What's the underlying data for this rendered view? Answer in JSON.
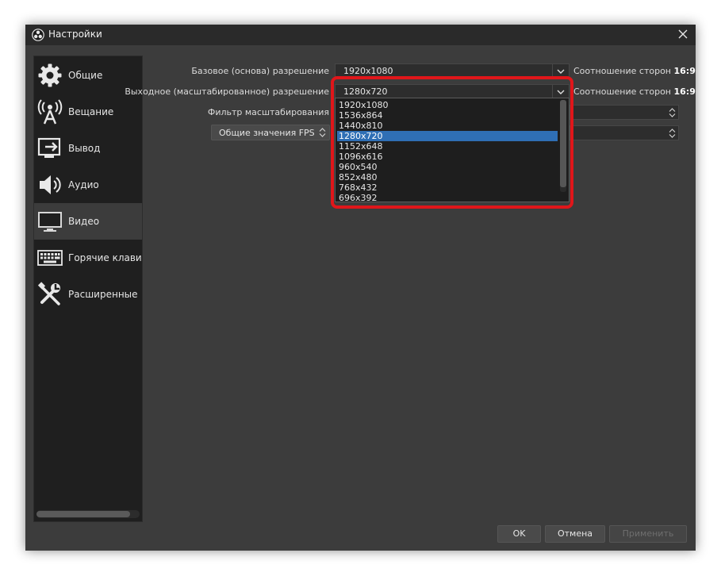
{
  "window": {
    "title": "Настройки"
  },
  "sidebar": {
    "items": [
      {
        "label": "Общие",
        "icon": "gear-icon"
      },
      {
        "label": "Вещание",
        "icon": "broadcast-icon"
      },
      {
        "label": "Вывод",
        "icon": "output-icon"
      },
      {
        "label": "Аудио",
        "icon": "speaker-icon"
      },
      {
        "label": "Видео",
        "icon": "monitor-icon",
        "active": true
      },
      {
        "label": "Горячие клавиши",
        "icon": "keyboard-icon"
      },
      {
        "label": "Расширенные",
        "icon": "tools-icon"
      }
    ]
  },
  "video": {
    "base_label": "Базовое (основа) разрешение",
    "base_value": "1920x1080",
    "base_aspect_text": "Соотношение сторон ",
    "base_aspect_ratio": "16:9",
    "output_label": "Выходное (масштабированное) разрешение",
    "output_value": "1280x720",
    "output_aspect_text": "Соотношение сторон ",
    "output_aspect_ratio": "16:9",
    "filter_label": "Фильтр масштабирования",
    "fps_label": "Общие значения FPS",
    "resolution_options": [
      "1920x1080",
      "1536x864",
      "1440x810",
      "1280x720",
      "1152x648",
      "1096x616",
      "960x540",
      "852x480",
      "768x432",
      "696x392"
    ],
    "selected_option": "1280x720"
  },
  "buttons": {
    "ok": "OK",
    "cancel": "Отмена",
    "apply": "Применить"
  },
  "colors": {
    "highlight": "#e0161a",
    "selection": "#2f6fb5"
  }
}
